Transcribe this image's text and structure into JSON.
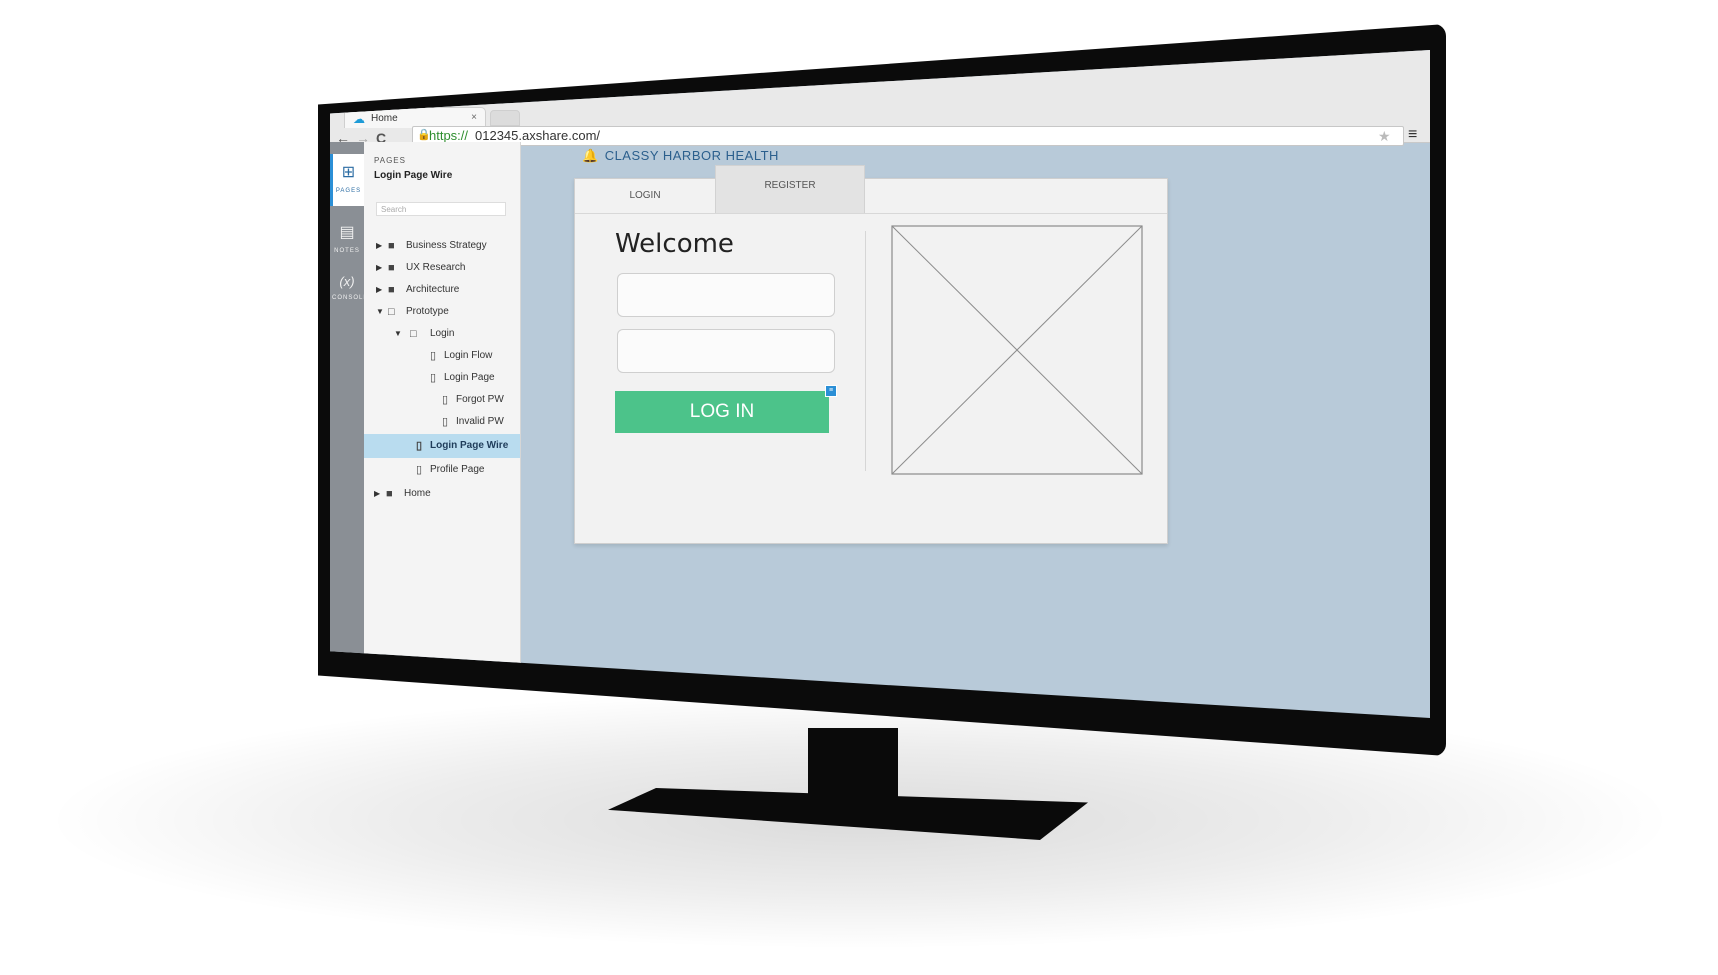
{
  "browser": {
    "tab_title": "Home",
    "tab_close": "×",
    "url_scheme": "https://",
    "url_rest": "012345.axshare.com/",
    "back": "←",
    "forward": "→",
    "reload": "C",
    "menu": "≡",
    "star": "★"
  },
  "rail": {
    "items": [
      {
        "label": "PAGES",
        "icon": "sitemap-icon",
        "glyph": "⊞"
      },
      {
        "label": "NOTES",
        "icon": "notes-icon",
        "glyph": "▤"
      },
      {
        "label": "CONSOLE",
        "icon": "variables-icon",
        "glyph": "(x)"
      }
    ],
    "chevron": "⌄"
  },
  "pages_panel": {
    "caption": "PAGES",
    "current_page": "Login Page Wire",
    "search_placeholder": "Search",
    "tree": [
      {
        "label": "Business Strategy",
        "type": "folder",
        "expanded": false
      },
      {
        "label": "UX Research",
        "type": "folder",
        "expanded": false
      },
      {
        "label": "Architecture",
        "type": "folder",
        "expanded": false
      },
      {
        "label": "Prototype",
        "type": "folder",
        "expanded": true
      },
      {
        "label": "Login",
        "type": "folder",
        "expanded": true
      },
      {
        "label": "Login Flow",
        "type": "page"
      },
      {
        "label": "Login Page",
        "type": "page"
      },
      {
        "label": "Forgot PW",
        "type": "page"
      },
      {
        "label": "Invalid PW",
        "type": "page"
      },
      {
        "label": "Login Page Wire",
        "type": "page",
        "selected": true
      },
      {
        "label": "Profile Page",
        "type": "page"
      },
      {
        "label": "Home",
        "type": "folder",
        "expanded": false
      }
    ]
  },
  "content": {
    "brand": "CLASSY HARBOR HEALTH",
    "tab_login": "LOGIN",
    "tab_register": "REGISTER",
    "welcome": "Welcome",
    "login_button": "LOG IN"
  },
  "colors": {
    "canvas": "#b8cad9",
    "login_button": "#4cc38a",
    "brand": "#2b5f8d",
    "selected_row": "#b9dcef"
  }
}
